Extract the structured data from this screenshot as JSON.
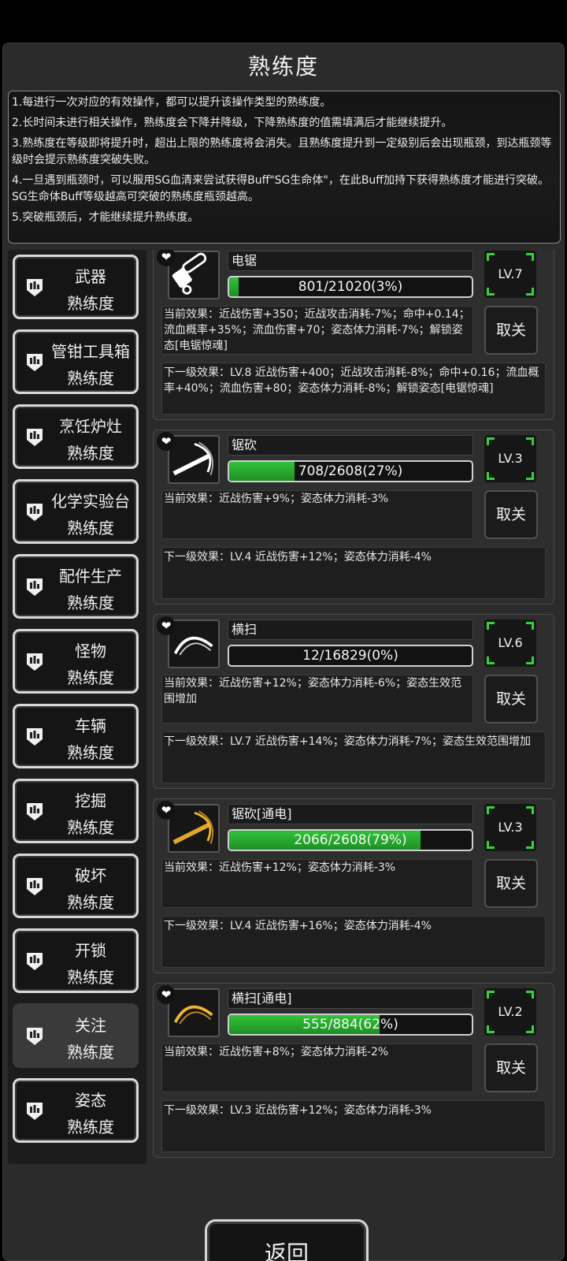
{
  "header": {
    "title": "熟练度"
  },
  "notes": [
    "1.每进行一次对应的有效操作，都可以提升该操作类型的熟练度。",
    "2.长时间未进行相关操作，熟练度会下降并降级，下降熟练度的值需填满后才能继续提升。",
    "3.熟练度在等级即将提升时，超出上限的熟练度将会消失。且熟练度提升到一定级别后会出现瓶颈，到达瓶颈等级时会提示熟练度突破失败。",
    "4.一旦遇到瓶颈时，可以服用SG血清来尝试获得Buff\"SG生命体\"，在此Buff加持下获得熟练度才能进行突破。SG生命体Buff等级越高可突破的熟练度瓶颈越高。",
    "5.突破瓶颈后，才能继续提升熟练度。"
  ],
  "categories": [
    {
      "line1": "武器",
      "line2": "熟练度",
      "active": false
    },
    {
      "line1": "管钳工具箱",
      "line2": "熟练度",
      "active": false
    },
    {
      "line1": "烹饪炉灶",
      "line2": "熟练度",
      "active": false
    },
    {
      "line1": "化学实验台",
      "line2": "熟练度",
      "active": false
    },
    {
      "line1": "配件生产",
      "line2": "熟练度",
      "active": false
    },
    {
      "line1": "怪物",
      "line2": "熟练度",
      "active": false
    },
    {
      "line1": "车辆",
      "line2": "熟练度",
      "active": false
    },
    {
      "line1": "挖掘",
      "line2": "熟练度",
      "active": false
    },
    {
      "line1": "破坏",
      "line2": "熟练度",
      "active": false
    },
    {
      "line1": "开锁",
      "line2": "熟练度",
      "active": false
    },
    {
      "line1": "关注",
      "line2": "熟练度",
      "active": true
    },
    {
      "line1": "姿态",
      "line2": "熟练度",
      "active": false
    }
  ],
  "skills": [
    {
      "icon": "chainsaw-icon",
      "name": "电锯",
      "progress_text": "801/21020(3%)",
      "progress": 0.038,
      "level": "LV.7",
      "current": "当前效果：近战伤害+350；近战攻击消耗-7%；命中+0.14；流血概率+35%；流血伤害+70；姿态体力消耗-7%；解锁姿态[电锯惊魂]",
      "button": "取关",
      "next": "下一级效果：LV.8 近战伤害+400；近战攻击消耗-8%；命中+0.16；流血概率+40%；流血伤害+80；姿态体力消耗-8%；解锁姿态[电锯惊魂]"
    },
    {
      "icon": "saw-slash-icon",
      "name": "锯砍",
      "progress_text": "708/2608(27%)",
      "progress": 0.27,
      "level": "LV.3",
      "current": "当前效果：近战伤害+9%；姿态体力消耗-3%",
      "button": "取关",
      "next": "下一级效果：LV.4 近战伤害+12%；姿态体力消耗-4%"
    },
    {
      "icon": "sweep-icon",
      "name": "横扫",
      "progress_text": "12/16829(0%)",
      "progress": 0.0,
      "level": "LV.6",
      "current": "当前效果：近战伤害+12%；姿态体力消耗-6%；姿态生效范围增加",
      "button": "取关",
      "next": "下一级效果：LV.7 近战伤害+14%；姿态体力消耗-7%；姿态生效范围增加"
    },
    {
      "icon": "electric-saw-slash-icon",
      "name": "锯砍[通电]",
      "progress_text": "2066/2608(79%)",
      "progress": 0.79,
      "level": "LV.3",
      "current": "当前效果：近战伤害+12%；姿态体力消耗-3%",
      "button": "取关",
      "next": "下一级效果：LV.4 近战伤害+16%；姿态体力消耗-4%"
    },
    {
      "icon": "electric-sweep-icon",
      "name": "横扫[通电]",
      "progress_text": "555/884(62%)",
      "progress": 0.62,
      "level": "LV.2",
      "current": "当前效果：近战伤害+8%；姿态体力消耗-2%",
      "button": "取关",
      "next": "下一级效果：LV.3 近战伤害+12%；姿态体力消耗-3%"
    }
  ],
  "footer": {
    "back_label": "返回"
  }
}
